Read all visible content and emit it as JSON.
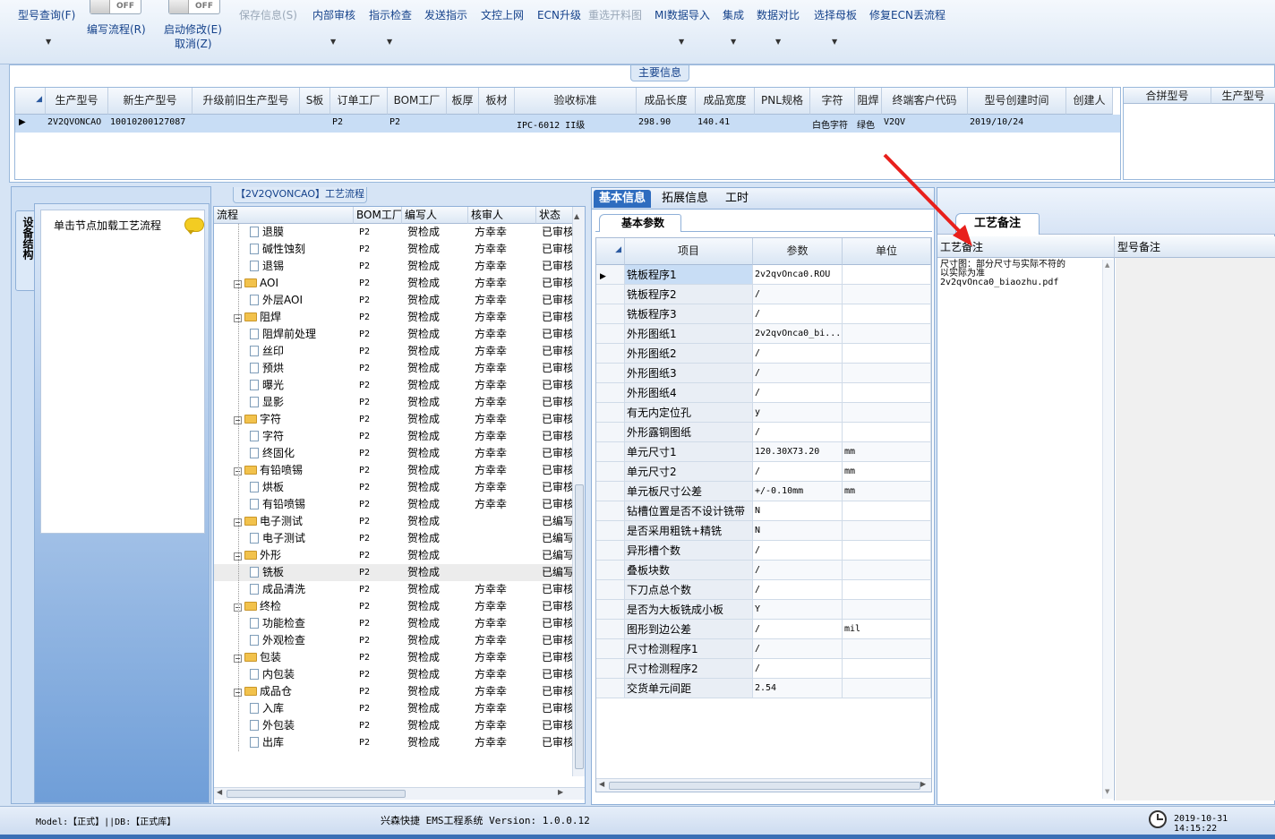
{
  "toolbar": {
    "items": [
      {
        "label": "型号查询(F)",
        "disabled": false
      },
      {
        "label": "编写流程(R)",
        "disabled": false
      },
      {
        "label": "启动修改(E)",
        "disabled": false
      },
      {
        "label": "取消(Z)",
        "disabled": false
      },
      {
        "label": "保存信息(S)",
        "disabled": true
      },
      {
        "label": "内部审核",
        "disabled": false
      },
      {
        "label": "指示检查",
        "disabled": false
      },
      {
        "label": "发送指示",
        "disabled": false
      },
      {
        "label": "文控上网",
        "disabled": false
      },
      {
        "label": "ECN升级",
        "disabled": false
      },
      {
        "label": "重选开料图",
        "disabled": true
      },
      {
        "label": "MI数据导入",
        "disabled": false
      },
      {
        "label": "集成",
        "disabled": false
      },
      {
        "label": "数据对比",
        "disabled": false
      },
      {
        "label": "选择母板",
        "disabled": false
      },
      {
        "label": "修复ECN丢流程",
        "disabled": false
      }
    ],
    "toggle_label": "OFF"
  },
  "main_info": {
    "title": "主要信息",
    "columns": [
      "生产型号",
      "新生产型号",
      "升级前旧生产型号",
      "S板",
      "订单工厂",
      "BOM工厂",
      "板厚",
      "板材",
      "验收标准",
      "成品长度",
      "成品宽度",
      "PNL规格",
      "字符",
      "阻焊",
      "终端客户代码",
      "型号创建时间",
      "创建人"
    ],
    "row": [
      "2V2QVONCAO",
      "10010200127087",
      "",
      "",
      "P2",
      "P2",
      "",
      "",
      "IPC-6012 II级",
      "298.90",
      "140.41",
      "",
      "白色字符",
      "绿色",
      "V2QV",
      "2019/10/24",
      ""
    ],
    "side_columns": [
      "合拼型号",
      "生产型号"
    ]
  },
  "left_panel": {
    "vertical_tab": "设备结构",
    "hint": "单击节点加载工艺流程"
  },
  "flow": {
    "title": "【2V2QVONCAO】工艺流程",
    "columns": [
      "流程",
      "BOM工厂",
      "编写人",
      "核审人",
      "状态"
    ],
    "rows": [
      {
        "level": 2,
        "name": "退膜",
        "bom": "P2",
        "writer": "贺检成",
        "reviewer": "方幸幸",
        "status": "已审核"
      },
      {
        "level": 2,
        "name": "碱性蚀刻",
        "bom": "P2",
        "writer": "贺检成",
        "reviewer": "方幸幸",
        "status": "已审核"
      },
      {
        "level": 2,
        "name": "退锡",
        "bom": "P2",
        "writer": "贺检成",
        "reviewer": "方幸幸",
        "status": "已审核"
      },
      {
        "level": 1,
        "name": "AOI",
        "bom": "P2",
        "writer": "贺检成",
        "reviewer": "方幸幸",
        "status": "已审核"
      },
      {
        "level": 2,
        "name": "外层AOI",
        "bom": "P2",
        "writer": "贺检成",
        "reviewer": "方幸幸",
        "status": "已审核"
      },
      {
        "level": 1,
        "name": "阻焊",
        "bom": "P2",
        "writer": "贺检成",
        "reviewer": "方幸幸",
        "status": "已审核"
      },
      {
        "level": 2,
        "name": "阻焊前处理",
        "bom": "P2",
        "writer": "贺检成",
        "reviewer": "方幸幸",
        "status": "已审核"
      },
      {
        "level": 2,
        "name": "丝印",
        "bom": "P2",
        "writer": "贺检成",
        "reviewer": "方幸幸",
        "status": "已审核"
      },
      {
        "level": 2,
        "name": "预烘",
        "bom": "P2",
        "writer": "贺检成",
        "reviewer": "方幸幸",
        "status": "已审核"
      },
      {
        "level": 2,
        "name": "曝光",
        "bom": "P2",
        "writer": "贺检成",
        "reviewer": "方幸幸",
        "status": "已审核"
      },
      {
        "level": 2,
        "name": "显影",
        "bom": "P2",
        "writer": "贺检成",
        "reviewer": "方幸幸",
        "status": "已审核"
      },
      {
        "level": 1,
        "name": "字符",
        "bom": "P2",
        "writer": "贺检成",
        "reviewer": "方幸幸",
        "status": "已审核"
      },
      {
        "level": 2,
        "name": "字符",
        "bom": "P2",
        "writer": "贺检成",
        "reviewer": "方幸幸",
        "status": "已审核"
      },
      {
        "level": 2,
        "name": "终固化",
        "bom": "P2",
        "writer": "贺检成",
        "reviewer": "方幸幸",
        "status": "已审核"
      },
      {
        "level": 1,
        "name": "有铅喷锡",
        "bom": "P2",
        "writer": "贺检成",
        "reviewer": "方幸幸",
        "status": "已审核"
      },
      {
        "level": 2,
        "name": "烘板",
        "bom": "P2",
        "writer": "贺检成",
        "reviewer": "方幸幸",
        "status": "已审核"
      },
      {
        "level": 2,
        "name": "有铅喷锡",
        "bom": "P2",
        "writer": "贺检成",
        "reviewer": "方幸幸",
        "status": "已审核"
      },
      {
        "level": 1,
        "name": "电子测试",
        "bom": "P2",
        "writer": "贺检成",
        "reviewer": "",
        "status": "已编写"
      },
      {
        "level": 2,
        "name": "电子测试",
        "bom": "P2",
        "writer": "贺检成",
        "reviewer": "",
        "status": "已编写"
      },
      {
        "level": 1,
        "name": "外形",
        "bom": "P2",
        "writer": "贺检成",
        "reviewer": "",
        "status": "已编写"
      },
      {
        "level": 2,
        "name": "铣板",
        "bom": "P2",
        "writer": "贺检成",
        "reviewer": "",
        "status": "已编写"
      },
      {
        "level": 2,
        "name": "成品清洗",
        "bom": "P2",
        "writer": "贺检成",
        "reviewer": "方幸幸",
        "status": "已审核"
      },
      {
        "level": 1,
        "name": "终检",
        "bom": "P2",
        "writer": "贺检成",
        "reviewer": "方幸幸",
        "status": "已审核"
      },
      {
        "level": 2,
        "name": "功能检查",
        "bom": "P2",
        "writer": "贺检成",
        "reviewer": "方幸幸",
        "status": "已审核"
      },
      {
        "level": 2,
        "name": "外观检查",
        "bom": "P2",
        "writer": "贺检成",
        "reviewer": "方幸幸",
        "status": "已审核"
      },
      {
        "level": 1,
        "name": "包装",
        "bom": "P2",
        "writer": "贺检成",
        "reviewer": "方幸幸",
        "status": "已审核"
      },
      {
        "level": 2,
        "name": "内包装",
        "bom": "P2",
        "writer": "贺检成",
        "reviewer": "方幸幸",
        "status": "已审核"
      },
      {
        "level": 1,
        "name": "成品仓",
        "bom": "P2",
        "writer": "贺检成",
        "reviewer": "方幸幸",
        "status": "已审核"
      },
      {
        "level": 2,
        "name": "入库",
        "bom": "P2",
        "writer": "贺检成",
        "reviewer": "方幸幸",
        "status": "已审核"
      },
      {
        "level": 2,
        "name": "外包装",
        "bom": "P2",
        "writer": "贺检成",
        "reviewer": "方幸幸",
        "status": "已审核"
      },
      {
        "level": 2,
        "name": "出库",
        "bom": "P2",
        "writer": "贺检成",
        "reviewer": "方幸幸",
        "status": "已审核"
      }
    ]
  },
  "detail": {
    "tabs": [
      "基本信息",
      "拓展信息",
      "工时"
    ],
    "subtab": "基本参数",
    "columns": [
      "项目",
      "参数",
      "单位"
    ],
    "rows": [
      {
        "item": "铣板程序1",
        "param": "2v2qvOnca0.ROU",
        "unit": ""
      },
      {
        "item": "铣板程序2",
        "param": "/",
        "unit": ""
      },
      {
        "item": "铣板程序3",
        "param": "/",
        "unit": ""
      },
      {
        "item": "外形图纸1",
        "param": "2v2qvOnca0_bi...",
        "unit": ""
      },
      {
        "item": "外形图纸2",
        "param": "/",
        "unit": ""
      },
      {
        "item": "外形图纸3",
        "param": "/",
        "unit": ""
      },
      {
        "item": "外形图纸4",
        "param": "/",
        "unit": ""
      },
      {
        "item": "有无内定位孔",
        "param": "y",
        "unit": ""
      },
      {
        "item": "外形露铜图纸",
        "param": "/",
        "unit": ""
      },
      {
        "item": "单元尺寸1",
        "param": "120.30X73.20",
        "unit": "mm"
      },
      {
        "item": "单元尺寸2",
        "param": "/",
        "unit": "mm"
      },
      {
        "item": "单元板尺寸公差",
        "param": "+/-0.10mm",
        "unit": "mm"
      },
      {
        "item": "钻槽位置是否不设计铣带",
        "param": "N",
        "unit": ""
      },
      {
        "item": "是否采用粗铣+精铣",
        "param": "N",
        "unit": ""
      },
      {
        "item": "异形槽个数",
        "param": "/",
        "unit": ""
      },
      {
        "item": "叠板块数",
        "param": "/",
        "unit": ""
      },
      {
        "item": "下刀点总个数",
        "param": "/",
        "unit": ""
      },
      {
        "item": "是否为大板铣成小板",
        "param": "Y",
        "unit": ""
      },
      {
        "item": "图形到边公差",
        "param": "/",
        "unit": "mil"
      },
      {
        "item": "尺寸检测程序1",
        "param": "/",
        "unit": ""
      },
      {
        "item": "尺寸检测程序2",
        "param": "/",
        "unit": ""
      },
      {
        "item": "交货单元间距",
        "param": "2.54",
        "unit": ""
      }
    ]
  },
  "notes": {
    "tab": "工艺备注",
    "col1": "工艺备注",
    "col2": "型号备注",
    "text_line1": "尺寸图：部分尺寸与实际不符的",
    "text_line2": "以实际为准",
    "text_line3": "2v2qvOnca0_biaozhu.pdf"
  },
  "status": {
    "model": "Model:【正式】||DB:【正式库】",
    "app": "兴森快捷 EMS工程系统 Version: 1.0.0.12",
    "datetime": "2019-10-31 14:15:22"
  },
  "colors": {
    "accent": "#15428b",
    "selected_row": "#c8ddf5",
    "annotation_arrow": "#e8201c"
  }
}
